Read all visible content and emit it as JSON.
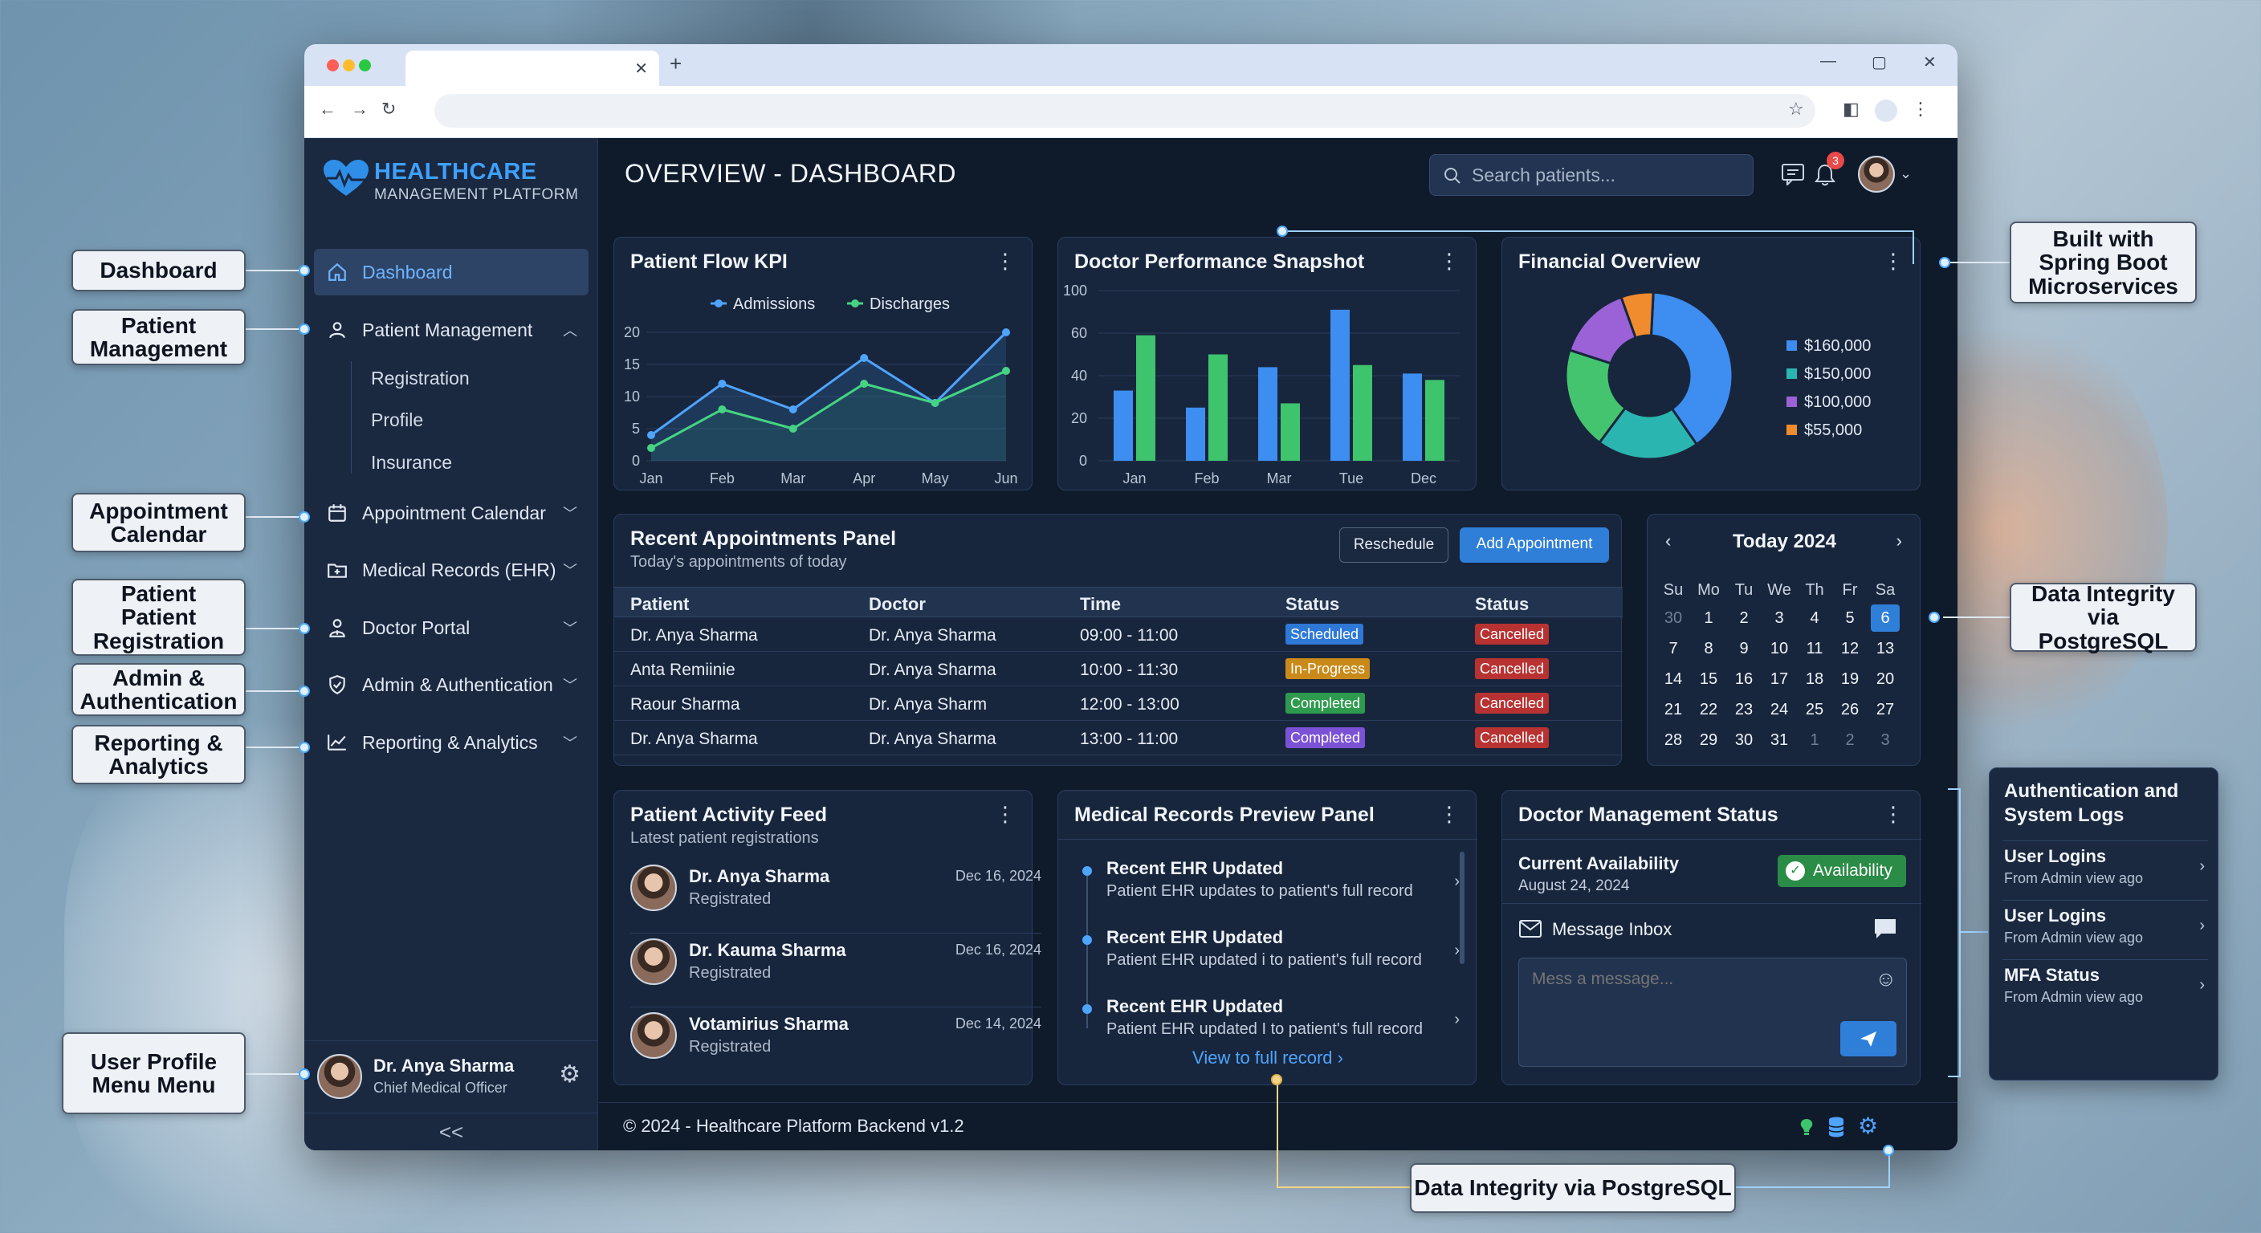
{
  "app": {
    "logo_title": "HEALTHCARE",
    "logo_subtitle": "MANAGEMENT PLATFORM",
    "page_title": "OVERVIEW - DASHBOARD",
    "search_placeholder": "Search patients...",
    "notification_count": "3",
    "footer_text": "© 2024 - Healthcare Platform Backend v1.2"
  },
  "sidebar": {
    "items": [
      {
        "label": "Dashboard",
        "icon": "home-icon",
        "active": true
      },
      {
        "label": "Patient Management",
        "icon": "user-icon",
        "expanded": true
      },
      {
        "label": "Appointment Calendar",
        "icon": "calendar-icon"
      },
      {
        "label": "Medical Records (EHR)",
        "icon": "folder-icon"
      },
      {
        "label": "Doctor Portal",
        "icon": "doctor-icon"
      },
      {
        "label": "Admin & Authentication",
        "icon": "shield-icon"
      },
      {
        "label": "Reporting & Analytics",
        "icon": "chart-icon"
      }
    ],
    "sub_items": [
      "Registration",
      "Profile",
      "Insurance"
    ],
    "profile": {
      "name": "Dr. Anya Sharma",
      "role": "Chief Medical Officer"
    },
    "collapse_label": "<<"
  },
  "patient_flow": {
    "title": "Patient Flow KPI",
    "chart_data": {
      "type": "line",
      "x": [
        "Jan",
        "Feb",
        "Mar",
        "Apr",
        "May",
        "Jun"
      ],
      "series": [
        {
          "name": "Admissions",
          "values": [
            4,
            12,
            8,
            16,
            9,
            20
          ]
        },
        {
          "name": "Discharges",
          "values": [
            2,
            8,
            5,
            12,
            9,
            14
          ]
        }
      ],
      "yticks": [
        0,
        5,
        10,
        15,
        20
      ],
      "ylim": [
        0,
        20
      ],
      "colors": [
        "#4ea4ff",
        "#45d483"
      ]
    }
  },
  "doctor_performance": {
    "title": "Doctor Performance Snapshot",
    "chart_data": {
      "type": "bar",
      "categories": [
        "Jan",
        "Feb",
        "Mar",
        "Tue",
        "Dec"
      ],
      "series": [
        {
          "values": [
            33,
            25,
            44,
            71,
            41
          ]
        },
        {
          "values": [
            59,
            50,
            27,
            45,
            38
          ]
        }
      ],
      "yticks": [
        0,
        20,
        40,
        60,
        100
      ],
      "ylim": [
        0,
        80
      ],
      "colors": [
        "#3d8ef0",
        "#3ec46d"
      ]
    }
  },
  "financial": {
    "title": "Financial Overview",
    "chart_data": {
      "type": "pie",
      "labels": [
        "$160,000",
        "$150,000",
        "$100,000",
        "$55,000"
      ],
      "values": [
        160000,
        150000,
        100000,
        55000
      ],
      "display_weights": [
        38,
        24,
        24,
        14
      ],
      "colors": [
        "#3d8ef0",
        "#2bb5b0",
        "#9a62d6",
        "#f08c2e"
      ],
      "extra_green_weight": 0
    }
  },
  "appointments": {
    "title": "Recent Appointments Panel",
    "subtitle": "Today's appointments of today",
    "reschedule_label": "Reschedule",
    "add_label": "Add Appointment",
    "columns": [
      "Patient",
      "Doctor",
      "Time",
      "Status",
      "Status"
    ],
    "rows": [
      {
        "patient": "Dr. Anya Sharma",
        "doctor": "Dr. Anya Sharma",
        "time": "09:00 - 11:00",
        "status": "Scheduled",
        "status_color": "#2e78d6",
        "status2": "Cancelled"
      },
      {
        "patient": "Anta Remiinie",
        "doctor": "Dr. Anya Sharma",
        "time": "10:00 - 11:30",
        "status": "In-Progress",
        "status_color": "#c98a1a",
        "status2": "Cancelled"
      },
      {
        "patient": "Raour Sharma",
        "doctor": "Dr. Anya Sharm",
        "time": "12:00 - 13:00",
        "status": "Completed",
        "status_color": "#2e9a4e",
        "status2": "Cancelled"
      },
      {
        "patient": "Dr. Anya Sharma",
        "doctor": "Dr. Anya Sharma",
        "time": "13:00 - 11:00",
        "status": "Completed",
        "status_color": "#7b52d6",
        "status2": "Cancelled"
      }
    ],
    "cancel_color": "#b83232"
  },
  "calendar": {
    "title": "Today 2024",
    "weekdays": [
      "Su",
      "Mo",
      "Tu",
      "We",
      "Th",
      "Fr",
      "Sa"
    ],
    "weeks": [
      [
        "30",
        "1",
        "2",
        "3",
        "4",
        "5",
        "6"
      ],
      [
        "7",
        "8",
        "9",
        "10",
        "11",
        "12",
        "13"
      ],
      [
        "14",
        "15",
        "16",
        "17",
        "18",
        "19",
        "20"
      ],
      [
        "21",
        "22",
        "23",
        "24",
        "25",
        "26",
        "27"
      ],
      [
        "28",
        "29",
        "30",
        "31",
        "1",
        "2",
        "3"
      ]
    ],
    "selected": "6"
  },
  "activity": {
    "title": "Patient Activity Feed",
    "subtitle": "Latest patient registrations",
    "items": [
      {
        "name": "Dr. Anya Sharma",
        "status": "Registrated",
        "date": "Dec 16, 2024"
      },
      {
        "name": "Dr. Kauma Sharma",
        "status": "Registrated",
        "date": "Dec 16, 2024"
      },
      {
        "name": "Votamirius Sharma",
        "status": "Registrated",
        "date": "Dec 14, 2024"
      }
    ]
  },
  "records": {
    "title": "Medical Records Preview Panel",
    "items": [
      {
        "title": "Recent EHR Updated",
        "desc": "Patient EHR updates to patient's full record"
      },
      {
        "title": "Recent EHR Updated",
        "desc": "Patient EHR updated i to patient's full record"
      },
      {
        "title": "Recent EHR Updated",
        "desc": "Patient EHR updated I to patient's full record"
      }
    ],
    "link_label": "View to full record"
  },
  "doctor_status": {
    "title": "Doctor Management Status",
    "availability_title": "Current Availability",
    "availability_date": "August 24, 2024",
    "availability_badge": "Availability",
    "inbox_label": "Message Inbox",
    "message_placeholder": "Mess a message..."
  },
  "auth_panel": {
    "title": "Authentication and System Logs",
    "items": [
      {
        "title": "User Logins",
        "sub": "From Admin view ago"
      },
      {
        "title": "User Logins",
        "sub": "From Admin view ago"
      },
      {
        "title": "MFA Status",
        "sub": "From Admin view ago"
      }
    ]
  },
  "callouts": {
    "dashboard": "Dashboard",
    "patient_mgmt": "Patient Management",
    "appointment": "Appointment Calendar",
    "registration": "Patient Patient Registration",
    "admin": "Admin & Authentication",
    "reporting": "Reporting & Analytics",
    "profile_menu": "User Profile Menu Menu",
    "spring": "Built with Spring Boot Microservices",
    "integrity_right": "Data Integrity via PostgreSQL",
    "integrity_bottom": "Data Integrity via PostgreSQL"
  }
}
